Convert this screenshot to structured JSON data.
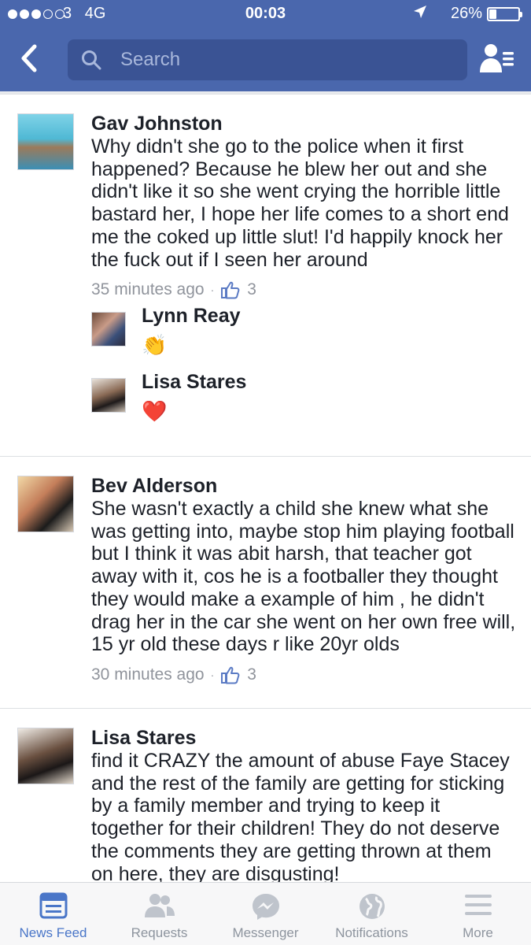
{
  "status_bar": {
    "carrier": "3",
    "network": "4G",
    "time": "00:03",
    "battery_pct_text": "26%",
    "battery_level": 0.26
  },
  "nav": {
    "search_placeholder": "Search",
    "back_icon": "chevron-left-icon",
    "friends_icon": "friend-list-icon"
  },
  "comments": [
    {
      "author": "Gav Johnston",
      "text": "Why didn't she go to the police when it first happened? Because he blew her out and she didn't like it so she went crying the horrible little bastard her, I hope her life comes to a short end me the coked up little slut! I'd happily knock her the fuck out if I seen her around",
      "time": "35 minutes ago",
      "sep": "·",
      "likes": "3",
      "replies": [
        {
          "author": "Lynn Reay",
          "emoji": "👏"
        },
        {
          "author": "Lisa Stares",
          "emoji": "❤️"
        }
      ]
    },
    {
      "author": "Bev Alderson",
      "text": "She wasn't exactly a child she knew what she was getting into, maybe stop him playing football but I think it was abit harsh, that teacher got away with it, cos he is a footballer they thought they would make a example of him , he didn't drag her in the car she went on her own free will, 15 yr old these days r like 20yr olds",
      "time": "30 minutes ago",
      "sep": "·",
      "likes": "3"
    },
    {
      "author": "Lisa Stares",
      "text": "find it CRAZY the amount of abuse Faye Stacey and the rest of the family are getting for sticking by a family member and trying to keep it together for their children! They do not deserve the comments they are getting thrown at them on here, they are disgusting!"
    }
  ],
  "tabbar": {
    "tabs": [
      {
        "label": "News Feed",
        "icon": "news-feed-icon",
        "active": true
      },
      {
        "label": "Requests",
        "icon": "friend-requests-icon"
      },
      {
        "label": "Messenger",
        "icon": "messenger-icon"
      },
      {
        "label": "Notifications",
        "icon": "globe-icon"
      },
      {
        "label": "More",
        "icon": "menu-icon"
      }
    ]
  },
  "colors": {
    "header": "#4a67ad",
    "search_bg": "#3a5394",
    "active_tab": "#4a76c8",
    "meta_text": "#90949c"
  }
}
